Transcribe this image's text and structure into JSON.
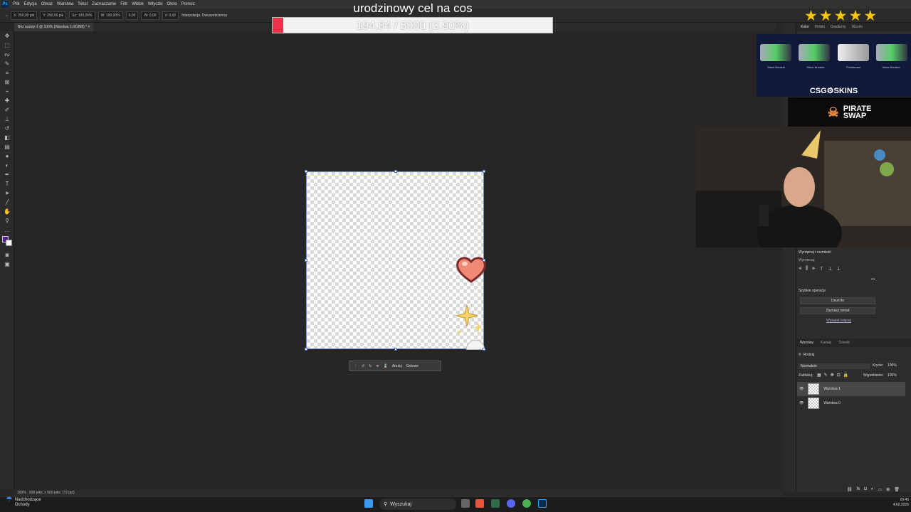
{
  "menubar": {
    "app_icon": "Ps",
    "items": [
      "Plik",
      "Edycja",
      "Obraz",
      "Warstwa",
      "Tekst",
      "Zaznaczanie",
      "Filtr",
      "Widok",
      "Wtyczki",
      "Okno",
      "Pomoc"
    ]
  },
  "optionsbar": {
    "x": "X: 250,00 pik",
    "y": "Y: 250,00 pik",
    "szer": "Sz: 100,00%",
    "wys": "W: 100,00%",
    "angle": "0,00",
    "h": "W: 0,00",
    "v": "V: 0,00",
    "interp": "Interpolacja: Dwusześcienna"
  },
  "document_tab": {
    "label": "Bez nazwy-1 @ 100% (Warstwa 1,RGB/8) *"
  },
  "stream_goal": {
    "title": "urodzinowy cel na cos",
    "progress_text": "194.84 / 5000 (3.90%)",
    "progress": 0.039,
    "color": "#e8334b"
  },
  "stars": {
    "count": 5,
    "color": "#f5c518"
  },
  "panel_tabs": {
    "items": [
      "Kolor",
      "Próbki",
      "Gradienty",
      "Wzorki"
    ]
  },
  "ad_csgo": {
    "label": "CSG⚙SKINS",
    "skins": [
      "Wave Breaker",
      "Wave Breaker",
      "Printstream",
      "Wave Breaker"
    ]
  },
  "ad_pirate": {
    "line1": "PIRATE",
    "line2": "SWAP"
  },
  "properties": {
    "align_title": "Wyrównaj i rozmieść",
    "align_sub": "Wyrównaj:",
    "quick_title": "Szybkie operacje",
    "remove_bg": "Usuń tło",
    "select_subject": "Zaznacz temat",
    "more_link": "Wyświetl więcej"
  },
  "layers_panel": {
    "tabs": [
      "Warstwy",
      "Kanały",
      "Ścieżki"
    ],
    "filter": "Rodzaj",
    "blend": "Normalnie",
    "opacity_label": "Krycie:",
    "opacity": "100%",
    "lock_label": "Zablokuj:",
    "fill_label": "Wypełnienie:",
    "fill": "100%",
    "layers": [
      "Warstwa 1",
      "Warstwa 0"
    ]
  },
  "context_bar": {
    "cancel": "Anuluj",
    "done": "Gotowe"
  },
  "statusbar": {
    "zoom": "100%",
    "size": "500 piks. x 500 piks. (72 ppi)"
  },
  "taskbar": {
    "weather_title": "Nadchodzące",
    "weather_sub": "Ochody",
    "search": "Wyszukaj",
    "time": "20:45",
    "date": "4.02.2026"
  }
}
